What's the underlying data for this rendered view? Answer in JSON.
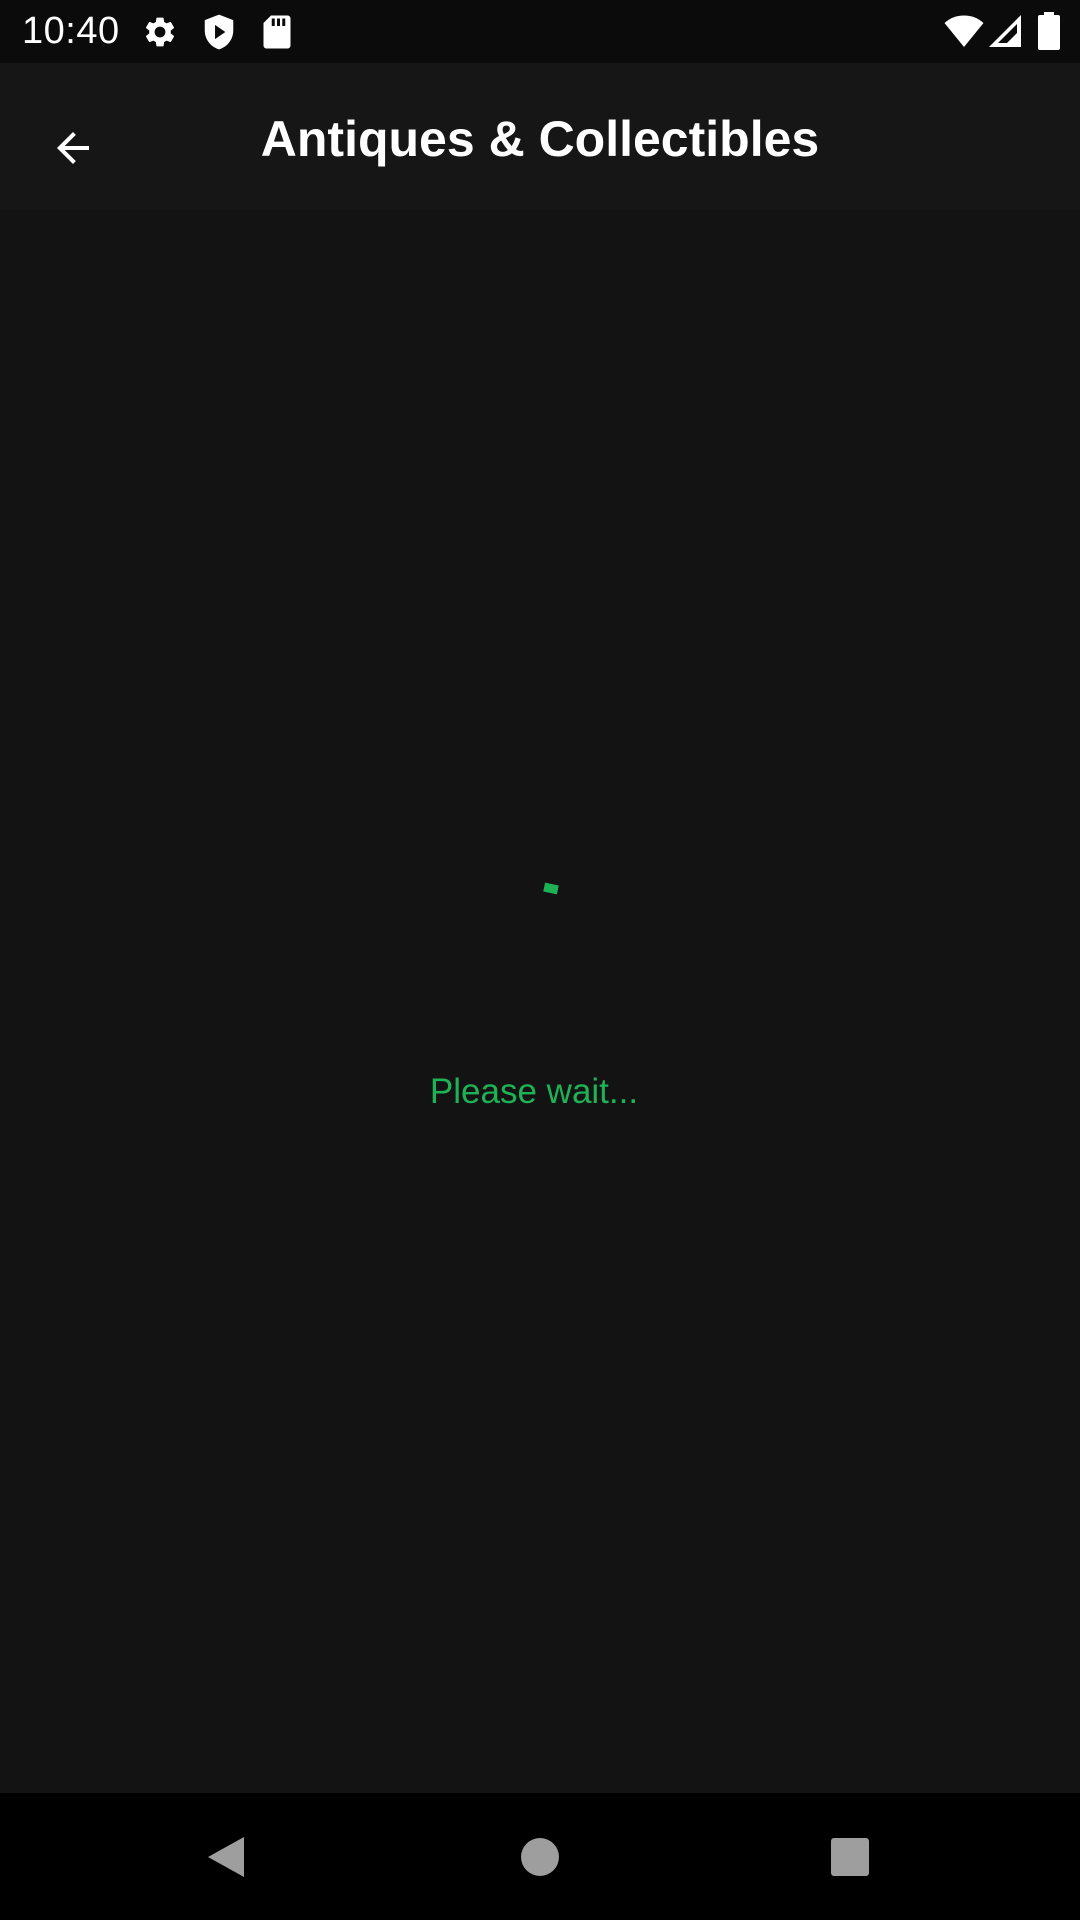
{
  "status_bar": {
    "time": "10:40",
    "icons_left": [
      "gear-icon",
      "shield-icon",
      "sd-card-icon"
    ],
    "icons_right": [
      "wifi-icon",
      "signal-icon",
      "battery-icon"
    ]
  },
  "app_bar": {
    "title": "Antiques & Collectibles",
    "back_icon": "arrow-back-icon"
  },
  "content": {
    "loading_text": "Please wait...",
    "accent_color": "#1fb155"
  },
  "nav_bar": {
    "buttons": [
      "back-triangle-icon",
      "home-circle-icon",
      "recents-square-icon"
    ]
  },
  "colors": {
    "background": "#131313",
    "status_bar": "#0b0b0b",
    "nav_bar": "#000000",
    "text": "#ffffff"
  }
}
